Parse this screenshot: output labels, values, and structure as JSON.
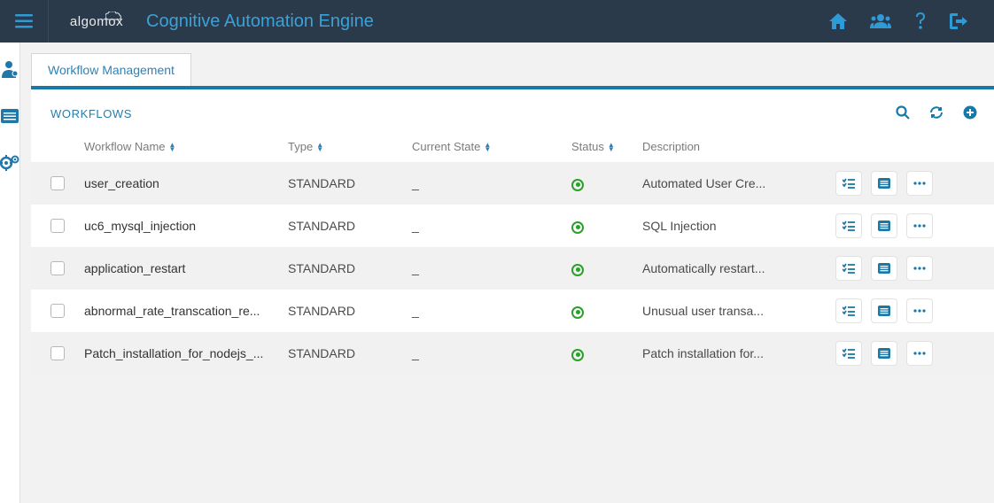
{
  "app_title": "Cognitive Automation Engine",
  "logo_text": "algomox",
  "tab": {
    "label": "Workflow Management"
  },
  "panel": {
    "title": "WORKFLOWS"
  },
  "columns": {
    "name": "Workflow Name",
    "type": "Type",
    "state": "Current State",
    "status": "Status",
    "desc": "Description"
  },
  "rows": [
    {
      "name": "user_creation",
      "type": "STANDARD",
      "state": "_",
      "desc": "Automated User Cre..."
    },
    {
      "name": "uc6_mysql_injection",
      "type": "STANDARD",
      "state": "_",
      "desc": "SQL Injection"
    },
    {
      "name": "application_restart",
      "type": "STANDARD",
      "state": "_",
      "desc": "Automatically restart..."
    },
    {
      "name": "abnormal_rate_transcation_re...",
      "type": "STANDARD",
      "state": "_",
      "desc": "Unusual user transa..."
    },
    {
      "name": "Patch_installation_for_nodejs_...",
      "type": "STANDARD",
      "state": "_",
      "desc": "Patch installation for..."
    }
  ]
}
